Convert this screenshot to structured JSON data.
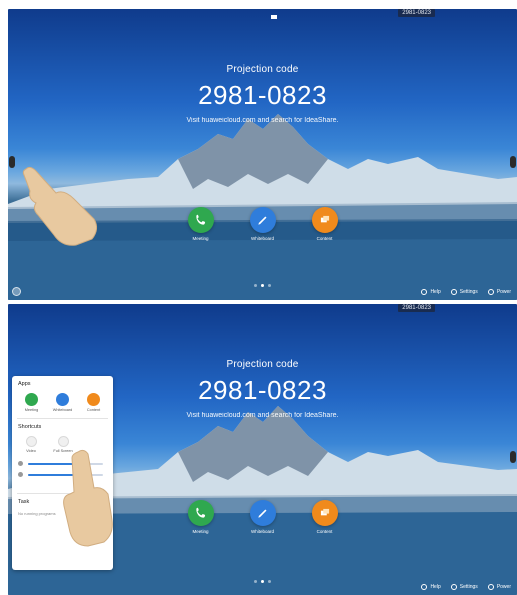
{
  "screens": [
    {
      "code_chip": "2981-0823",
      "title": "Projection code",
      "code": "2981-0823",
      "hint": "Visit huaweicloud.com and search for IdeaShare.",
      "apps": [
        {
          "label": "Meeting",
          "icon": "phone-icon",
          "color": "#2fa84f"
        },
        {
          "label": "Whiteboard",
          "icon": "pen-icon",
          "color": "#2f7ddb"
        },
        {
          "label": "Content",
          "icon": "files-icon",
          "color": "#f08a1c"
        }
      ],
      "bottom": {
        "help": "Help",
        "settings": "Settings",
        "power": "Power"
      }
    },
    {
      "code_chip": "2981-0823",
      "title": "Projection code",
      "code": "2981-0823",
      "hint": "Visit huaweicloud.com and search for IdeaShare.",
      "apps": [
        {
          "label": "Meeting",
          "icon": "phone-icon",
          "color": "#2fa84f"
        },
        {
          "label": "Whiteboard",
          "icon": "pen-icon",
          "color": "#2f7ddb"
        },
        {
          "label": "Content",
          "icon": "files-icon",
          "color": "#f08a1c"
        }
      ],
      "bottom": {
        "help": "Help",
        "settings": "Settings",
        "power": "Power"
      }
    }
  ],
  "panel": {
    "apps_title": "Apps",
    "apps": [
      {
        "label": "Meeting",
        "color": "#2fa84f"
      },
      {
        "label": "Whiteboard",
        "color": "#2f7ddb"
      },
      {
        "label": "Content",
        "color": "#f08a1c"
      }
    ],
    "shortcuts_title": "Shortcuts",
    "shortcuts": [
      {
        "label": "Video"
      },
      {
        "label": "Full Screen"
      }
    ],
    "task_title": "Task",
    "task_empty": "No running programs"
  }
}
